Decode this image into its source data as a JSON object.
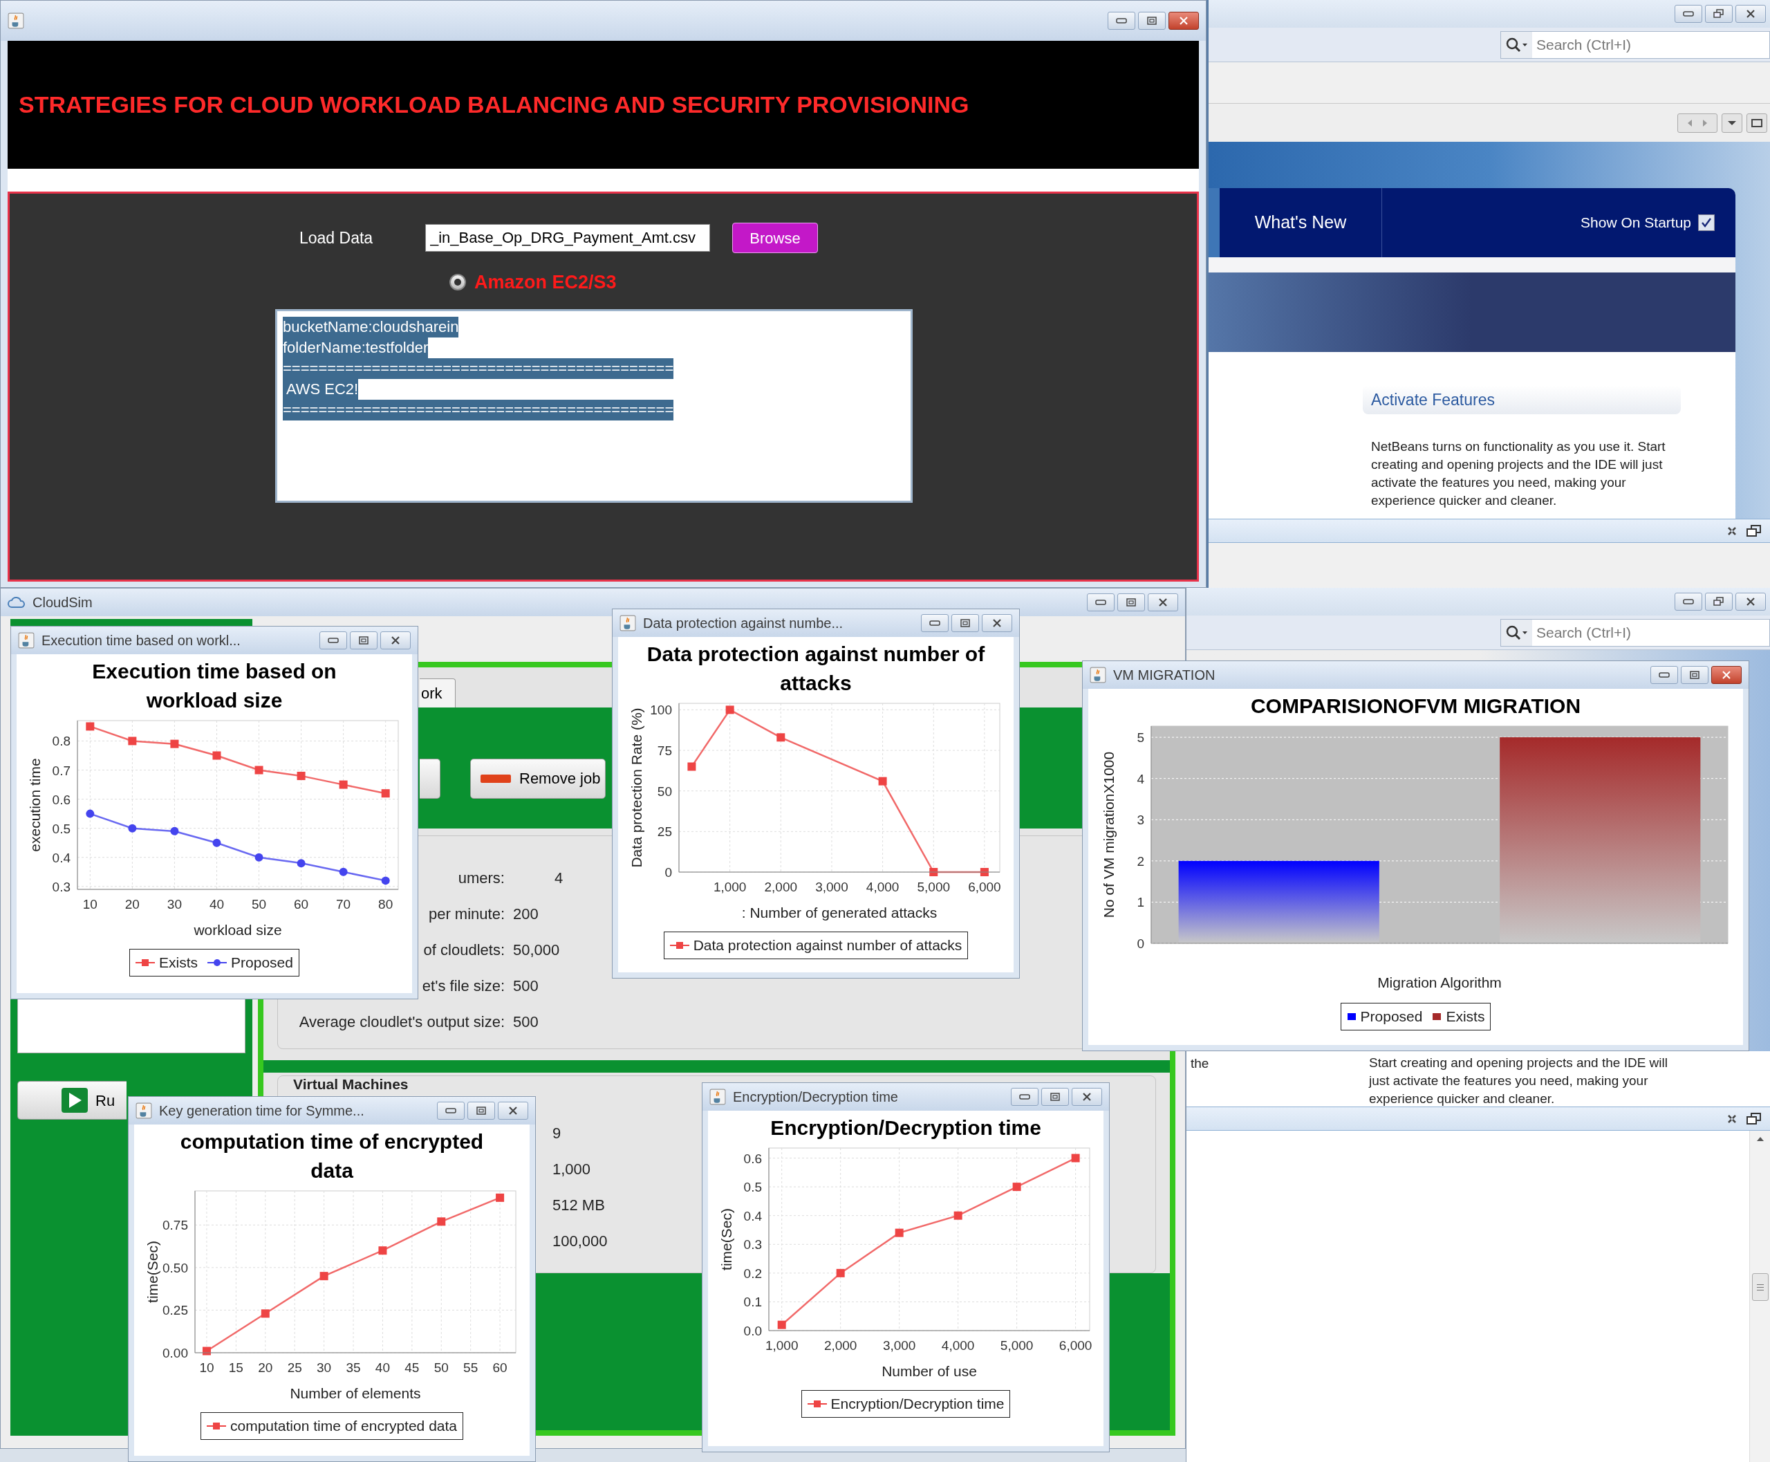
{
  "app_window": {
    "heading": "STRATEGIES FOR CLOUD WORKLOAD BALANCING AND SECURITY PROVISIONING",
    "load_data_label": "Load Data",
    "file_field_value": "_in_Base_Op_DRG_Payment_Amt.csv",
    "browse_button": "Browse",
    "radio": {
      "label": "Amazon EC2/S3",
      "selected": true
    },
    "output": {
      "selected": true,
      "lines": [
        "bucketName:cloudsharein",
        "folderName:testfolder",
        "============================================",
        " AWS EC2!",
        "============================================"
      ]
    }
  },
  "netbeans_top": {
    "search_placeholder": "Search (Ctrl+I)",
    "tab": "What's New",
    "show_on_startup": {
      "label": "Show On Startup",
      "checked": true
    },
    "section_title": "Activate Features",
    "paragraph": "NetBeans turns on functionality as you use it. Start creating and opening projects and the IDE will just activate the features you need, making your experience quicker and cleaner."
  },
  "cloudsim": {
    "title": "CloudSim",
    "tab": "ork",
    "remove_job_button": "Remove job",
    "run_button": "Ru",
    "info_rows": [
      {
        "label": "umers:",
        "value": "4"
      },
      {
        "label": "per minute:",
        "value": "200"
      },
      {
        "label": "of cloudlets:",
        "value": "50,000"
      },
      {
        "label": "et's file size:",
        "value": "500"
      },
      {
        "label": "Average cloudlet's output size:",
        "value": "500"
      }
    ],
    "vm_header": "Virtual Machines",
    "vm_values": [
      "9",
      "1,000",
      "512 MB",
      "100,000"
    ]
  },
  "netbeans_bottom": {
    "search_placeholder": "Search (Ctrl+I)",
    "side_text": "the",
    "paragraph": "Start creating and opening projects and the IDE will just activate the features you need, making your experience quicker and cleaner."
  },
  "chart_windows": [
    {
      "title": "Execution time based on workl...",
      "chart_data": {
        "type": "line",
        "title": "Execution time based on workload size",
        "xlabel": "workload size",
        "ylabel": "execution time",
        "x": [
          10,
          20,
          30,
          40,
          50,
          60,
          70,
          80
        ],
        "series": [
          {
            "name": "Exists",
            "color": "#ee4444",
            "marker": "square",
            "values": [
              0.85,
              0.8,
              0.79,
              0.75,
              0.7,
              0.68,
              0.65,
              0.62
            ]
          },
          {
            "name": "Proposed",
            "color": "#4444ee",
            "marker": "circle",
            "values": [
              0.55,
              0.5,
              0.49,
              0.45,
              0.4,
              0.38,
              0.35,
              0.32
            ]
          }
        ],
        "grid": true,
        "legend": true,
        "xlim": [
          7,
          83
        ],
        "ylim": [
          0.29,
          0.87
        ],
        "xticks": [
          10,
          20,
          30,
          40,
          50,
          60,
          70,
          80
        ],
        "yticks": [
          0.3,
          0.4,
          0.5,
          0.6,
          0.7,
          0.8
        ]
      }
    },
    {
      "title": "Data protection against numbe...",
      "chart_data": {
        "type": "line",
        "title": "Data protection against number of attacks",
        "xlabel": ": Number of generated attacks",
        "ylabel": "Data protection Rate (%)",
        "x": [
          250,
          1000,
          2000,
          4000,
          5000,
          6000
        ],
        "series": [
          {
            "name": "Data protection against number of attacks",
            "color": "#ee4444",
            "marker": "square",
            "values": [
              65,
              100,
              83,
              56,
              0,
              0
            ]
          }
        ],
        "grid": true,
        "legend": true,
        "xlim": [
          0,
          6300
        ],
        "ylim": [
          0,
          104
        ],
        "xticks": [
          {
            "value": 1000,
            "label": "1,000"
          },
          {
            "value": 2000,
            "label": "2,000"
          },
          {
            "value": 3000,
            "label": "3,000"
          },
          {
            "value": 4000,
            "label": "4,000"
          },
          {
            "value": 5000,
            "label": "5,000"
          },
          {
            "value": 6000,
            "label": "6,000"
          }
        ],
        "yticks": [
          0,
          25,
          50,
          75,
          100
        ]
      }
    },
    {
      "title": "VM MIGRATION",
      "chart_data": {
        "type": "bar",
        "title": "COMPARISIONOFVM MIGRATION",
        "xlabel": "Migration Algorithm",
        "ylabel": "No of VM migrationX1000",
        "series": [
          {
            "name": "Proposed",
            "color": "#0000ff",
            "values": [
              2
            ]
          },
          {
            "name": "Exists",
            "color": "#a52a2a",
            "values": [
              5
            ]
          }
        ],
        "grid": true,
        "legend": true,
        "ylim": [
          0,
          5.27
        ],
        "yticks": [
          0,
          1,
          2,
          3,
          4,
          5
        ]
      }
    },
    {
      "title": "Key generation time for Symme...",
      "chart_data": {
        "type": "line",
        "title": "computation time of encrypted data",
        "xlabel": "Number of elements",
        "ylabel": "time(Sec)",
        "x": [
          10,
          20,
          30,
          40,
          50,
          60
        ],
        "series": [
          {
            "name": "computation time of encrypted data",
            "color": "#ee4444",
            "marker": "square",
            "values": [
              0.01,
              0.23,
              0.45,
              0.6,
              0.77,
              0.91
            ]
          }
        ],
        "grid": true,
        "legend": true,
        "xlim": [
          8,
          62.7
        ],
        "ylim": [
          0,
          0.95
        ],
        "xticks": [
          10,
          15,
          20,
          25,
          30,
          35,
          40,
          45,
          50,
          55,
          60
        ],
        "yticks": [
          {
            "value": 0,
            "label": "0.00"
          },
          {
            "value": 0.25,
            "label": "0.25"
          },
          {
            "value": 0.5,
            "label": "0.50"
          },
          {
            "value": 0.75,
            "label": "0.75"
          }
        ]
      }
    },
    {
      "title": "Encryption/Decryption time",
      "chart_data": {
        "type": "line",
        "title": "Encryption/Decryption time",
        "xlabel": "Number of use",
        "ylabel": "time(Sec)",
        "x": [
          1000,
          2000,
          3000,
          4000,
          5000,
          6000
        ],
        "series": [
          {
            "name": "Encryption/Decryption time",
            "color": "#ee4444",
            "marker": "square",
            "values": [
              0.02,
              0.2,
              0.34,
              0.4,
              0.5,
              0.6
            ]
          }
        ],
        "grid": true,
        "legend": true,
        "xlim": [
          780,
          6240
        ],
        "ylim": [
          0,
          0.635
        ],
        "xticks": [
          {
            "value": 1000,
            "label": "1,000"
          },
          {
            "value": 2000,
            "label": "2,000"
          },
          {
            "value": 3000,
            "label": "3,000"
          },
          {
            "value": 4000,
            "label": "4,000"
          },
          {
            "value": 5000,
            "label": "5,000"
          },
          {
            "value": 6000,
            "label": "6,000"
          }
        ],
        "yticks": [
          {
            "value": 0,
            "label": "0.0"
          },
          0.1,
          0.2,
          0.3,
          0.4,
          0.5,
          0.6
        ]
      }
    }
  ]
}
